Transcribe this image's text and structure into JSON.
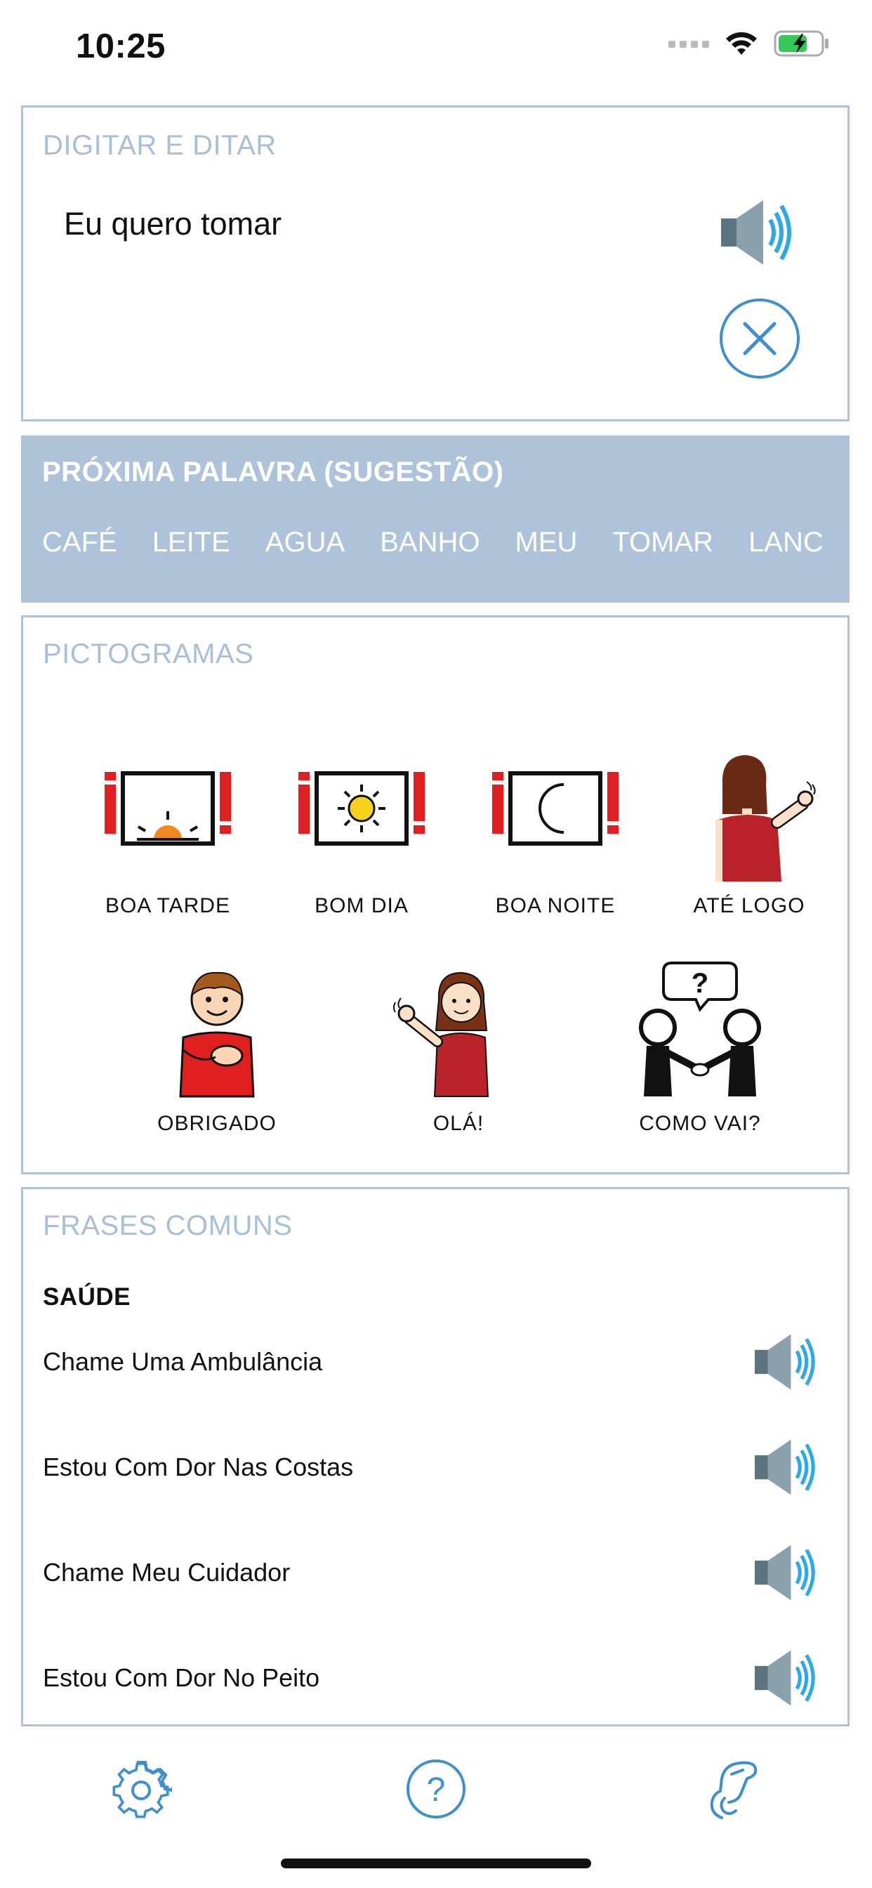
{
  "status": {
    "time": "10:25"
  },
  "type_dictate": {
    "title": "DIGITAR E DITAR",
    "text": "Eu quero tomar"
  },
  "suggestions": {
    "title": "PRÓXIMA PALAVRA (SUGESTÃO)",
    "words": [
      "CAFÉ",
      "LEITE",
      "AGUA",
      "BANHO",
      "MEU",
      "TOMAR",
      "LANC"
    ]
  },
  "pictograms": {
    "title": "PICTOGRAMAS",
    "items": [
      {
        "label": "BOA TARDE",
        "icon": "good-afternoon-pictogram"
      },
      {
        "label": "BOM DIA",
        "icon": "good-morning-pictogram"
      },
      {
        "label": "BOA NOITE",
        "icon": "good-night-pictogram"
      },
      {
        "label": "ATÉ LOGO",
        "icon": "goodbye-pictogram"
      },
      {
        "label": "OBRIGADO",
        "icon": "thank-you-pictogram"
      },
      {
        "label": "OLÁ!",
        "icon": "hello-pictogram"
      },
      {
        "label": "COMO VAI?",
        "icon": "how-are-you-pictogram"
      }
    ]
  },
  "phrases": {
    "title": "FRASES COMUNS",
    "category": "SAÚDE",
    "items": [
      "Chame Uma Ambulância",
      "Estou Com Dor Nas Costas",
      "Chame Meu Cuidador",
      "Estou Com Dor No Peito"
    ]
  },
  "toolbar": {
    "icons": [
      "settings-icon",
      "help-icon",
      "sign-language-icon"
    ]
  },
  "colors": {
    "accent": "#3d8fd0",
    "panel_border": "#aec3da",
    "section_title": "#a8bfd8",
    "red": "#e02020"
  }
}
